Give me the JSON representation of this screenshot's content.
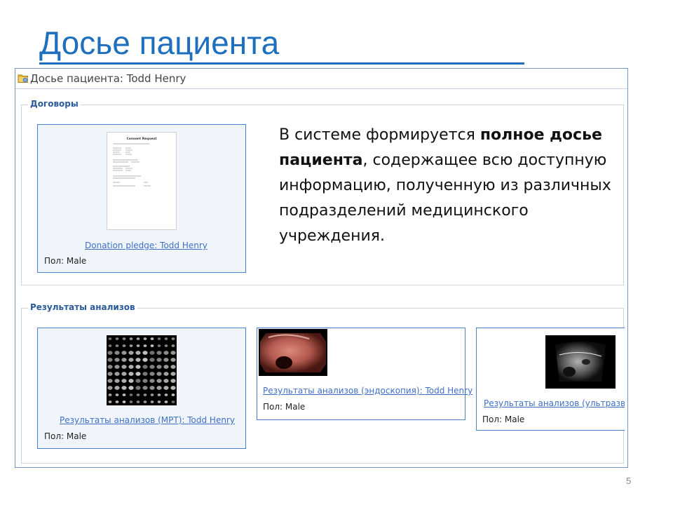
{
  "slide": {
    "title": "Досье пациента",
    "page_number": "5"
  },
  "window": {
    "title": "Досье пациента: Todd Henry",
    "icon": "folder-icon"
  },
  "contracts": {
    "legend": "Договоры",
    "card": {
      "link": "Donation pledge: Todd Henry",
      "meta": "Пол: Male",
      "thumbnail": "document-thumbnail",
      "doc_heading": "Consent Request"
    }
  },
  "description": {
    "part1": "В системе формируется ",
    "bold": "полное досье пациента",
    "part2": ", содержащее всю доступную информацию, полученную из различных подразделений медицинского учреждения."
  },
  "results": {
    "legend": "Результаты анализов",
    "cards": [
      {
        "link": "Результаты анализов (МРТ): Todd Henry",
        "meta": "Пол: Male",
        "thumbnail": "mri-thumbnail"
      },
      {
        "link": "Результаты анализов (эндоскопия): Todd Henry",
        "meta": "Пол: Male",
        "thumbnail": "endoscopy-thumbnail"
      },
      {
        "link": "Результаты анализов (ультразвук)",
        "meta": "Пол: Male",
        "thumbnail": "ultrasound-thumbnail"
      }
    ]
  },
  "colors": {
    "title": "#1f6fbf",
    "link": "#3f6fc4",
    "legend": "#2a5a9a",
    "card_border": "#4a80d0"
  }
}
